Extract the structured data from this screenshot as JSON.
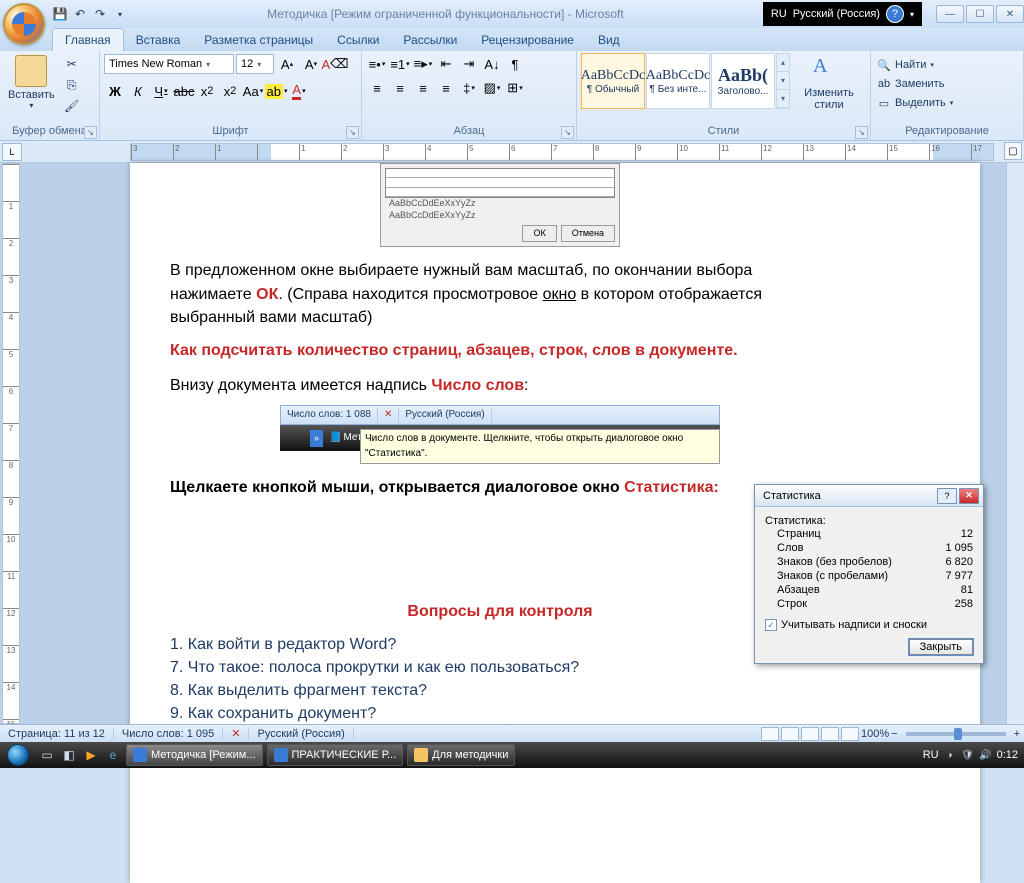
{
  "title": "Методичка [Режим ограниченной функциональности] - Microsoft",
  "lang_indicator": {
    "code": "RU",
    "name": "Русский (Россия)"
  },
  "tabs": {
    "home": "Главная",
    "insert": "Вставка",
    "layout": "Разметка страницы",
    "refs": "Ссылки",
    "mail": "Рассылки",
    "review": "Рецензирование",
    "view": "Вид"
  },
  "ribbon": {
    "clipboard": {
      "label": "Буфер обмена",
      "paste": "Вставить"
    },
    "font": {
      "label": "Шрифт",
      "name": "Times New Roman",
      "size": "12"
    },
    "paragraph": {
      "label": "Абзац"
    },
    "styles": {
      "label": "Стили",
      "items": [
        {
          "preview": "AaBbCcDc",
          "name": "¶ Обычный"
        },
        {
          "preview": "AaBbCcDc",
          "name": "¶ Без инте..."
        },
        {
          "preview": "AaBb(",
          "name": "Заголово..."
        }
      ],
      "change": "Изменить стили"
    },
    "editing": {
      "label": "Редактирование",
      "find": "Найти",
      "replace": "Заменить",
      "select": "Выделить"
    }
  },
  "ruler": {
    "marks": [
      "3",
      "2",
      "1",
      "",
      "1",
      "2",
      "3",
      "4",
      "5",
      "6",
      "7",
      "8",
      "9",
      "10",
      "11",
      "12",
      "13",
      "14",
      "15",
      "16",
      "17"
    ]
  },
  "vruler": {
    "marks": [
      "",
      "1",
      "2",
      "3",
      "4",
      "5",
      "6",
      "7",
      "8",
      "9",
      "10",
      "11",
      "12",
      "13",
      "14",
      "15"
    ]
  },
  "doc": {
    "embed_fonts": [
      "AaBbCcDdEeXxYyZz",
      "AaBbCcDdEeXxYyZz"
    ],
    "embed_ok": "ОК",
    "embed_cancel": "Отмена",
    "p1_a": "В предложенном окне выбираете нужный вам масштаб, по окончании выбора нажимаете ",
    "p1_ok": "ОК",
    "p1_b": ". (Справа находится просмотровое ",
    "p1_u": "окно",
    "p1_c": " в котором отображается выбранный вами масштаб)",
    "h1": "Как подсчитать количество страниц, абзацев, строк, слов в документе.",
    "p2_a": "Внизу документа имеется надпись ",
    "p2_b": "Число слов",
    "p2_c": ":",
    "status_img": {
      "words": "Число слов: 1 088",
      "lang": "Русский (Россия)",
      "task": "Мето",
      "tooltip": "Число слов в документе. Щелкните, чтобы открыть диалоговое окно \"Статистика\"."
    },
    "p3_a": "Щелкаете кнопкой мыши, открывается диалоговое окно ",
    "p3_b": "Статистика:",
    "h2": "Вопросы для контроля",
    "q1_a": "1. Как войти в редактор ",
    "q1_b": "Word",
    "q1_c": "?",
    "q7": "7. Что такое: полоса прокрутки и как ею пользоваться?",
    "q8": "8. Как выделить фрагмент текста?",
    "q9": "9. Как сохранить документ?"
  },
  "stats_dialog": {
    "title": "Статистика",
    "heading": "Статистика:",
    "rows": [
      {
        "label": "Страниц",
        "value": "12"
      },
      {
        "label": "Слов",
        "value": "1 095"
      },
      {
        "label": "Знаков (без пробелов)",
        "value": "6 820"
      },
      {
        "label": "Знаков (с пробелами)",
        "value": "7 977"
      },
      {
        "label": "Абзацев",
        "value": "81"
      },
      {
        "label": "Строк",
        "value": "258"
      }
    ],
    "checkbox": "Учитывать надписи и сноски",
    "close": "Закрыть"
  },
  "word_status": {
    "page": "Страница: 11 из 12",
    "words": "Число слов: 1 095",
    "lang": "Русский (Россия)",
    "zoom": "100%"
  },
  "taskbar": {
    "items": [
      {
        "label": "Методичка [Режим..."
      },
      {
        "label": "ПРАКТИЧЕСКИЕ Р..."
      },
      {
        "label": "Для методички"
      }
    ],
    "lang": "RU",
    "time": "0:12"
  }
}
